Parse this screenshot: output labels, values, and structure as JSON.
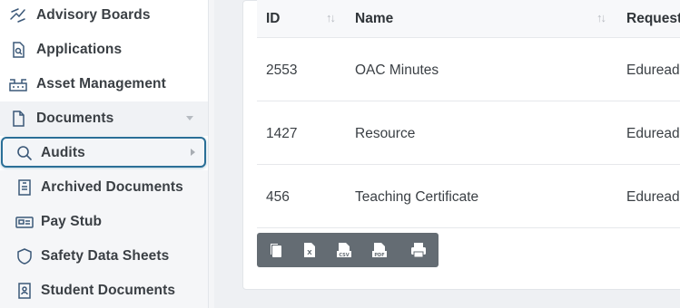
{
  "sidebar": {
    "items": [
      {
        "label": "Advisory Boards",
        "icon": "advisory-boards-icon"
      },
      {
        "label": "Applications",
        "icon": "applications-icon"
      },
      {
        "label": "Asset Management",
        "icon": "asset-management-icon"
      },
      {
        "label": "Documents",
        "icon": "document-icon"
      },
      {
        "label": "Audits",
        "icon": "search-icon"
      },
      {
        "label": "Archived Documents",
        "icon": "archive-icon"
      },
      {
        "label": "Pay Stub",
        "icon": "pay-stub-icon"
      },
      {
        "label": "Safety Data Sheets",
        "icon": "shield-icon"
      },
      {
        "label": "Student Documents",
        "icon": "student-document-icon"
      }
    ]
  },
  "table": {
    "columns": [
      "ID",
      "Name",
      "Request"
    ],
    "rows": [
      {
        "id": "2553",
        "name": "OAC Minutes",
        "request": "Eduread"
      },
      {
        "id": "1427",
        "name": "Resource",
        "request": "Eduread"
      },
      {
        "id": "456",
        "name": "Teaching Certificate",
        "request": "Eduread"
      }
    ]
  },
  "toolbar": {
    "buttons": [
      "copy-icon",
      "excel-icon",
      "csv-icon",
      "pdf-icon",
      "print-icon"
    ],
    "excel_glyph": "X",
    "csv_glyph": "CSV",
    "pdf_glyph": "PDF"
  },
  "colors": {
    "accent": "#2a6f97",
    "toolbar_bg": "#646c73",
    "icon": "#3b5878"
  }
}
